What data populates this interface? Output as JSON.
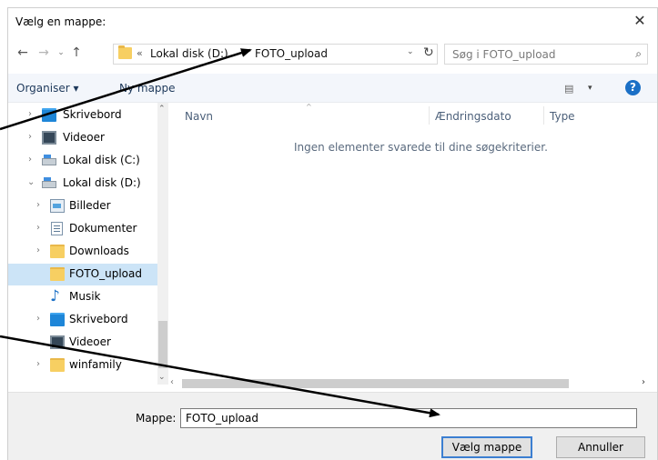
{
  "window": {
    "title": "Vælg en mappe:",
    "close_glyph": "✕"
  },
  "address_bar": {
    "back_glyph": "←",
    "forward_glyph": "→",
    "history_glyph": "⌄",
    "up_glyph": "↑",
    "overflow": "«",
    "crumbs": [
      "Lokal disk (D:)",
      "FOTO_upload"
    ],
    "separator": "›",
    "dropdown_glyph": "⌄",
    "refresh_glyph": "↻"
  },
  "search": {
    "placeholder": "Søg i FOTO_upload",
    "icon_glyph": "⌕"
  },
  "toolbar": {
    "organise_label": "Organiser ▾",
    "new_folder_label": "Ny mappe",
    "view_glyph": "▤",
    "view_dropdown_glyph": "▾",
    "help_glyph": "?"
  },
  "nav_tree": {
    "items": [
      {
        "label": "Skrivebord",
        "icon": "desktop-icon",
        "arrow": "›"
      },
      {
        "label": "Videoer",
        "icon": "video-icon",
        "arrow": "›"
      },
      {
        "label": "Lokal disk (C:)",
        "icon": "drive-icon",
        "arrow": "›"
      },
      {
        "label": "Lokal disk (D:)",
        "icon": "drive-icon",
        "arrow": "⌄"
      },
      {
        "label": "Billeder",
        "icon": "pictures-icon",
        "arrow": "›"
      },
      {
        "label": "Dokumenter",
        "icon": "documents-icon",
        "arrow": "›"
      },
      {
        "label": "Downloads",
        "icon": "folder-icon",
        "arrow": "›"
      },
      {
        "label": "FOTO_upload",
        "icon": "folder-icon",
        "arrow": ""
      },
      {
        "label": "Musik",
        "icon": "music-icon",
        "arrow": ""
      },
      {
        "label": "Skrivebord",
        "icon": "desktop-icon",
        "arrow": "›"
      },
      {
        "label": "Videoer",
        "icon": "video-icon",
        "arrow": ""
      },
      {
        "label": "winfamily",
        "icon": "folder-icon",
        "arrow": "›"
      }
    ],
    "selected_item": "FOTO_upload"
  },
  "scrollbars": {
    "up_glyph": "⌃",
    "down_glyph": "⌄",
    "left_glyph": "‹",
    "right_glyph": "›"
  },
  "file_list": {
    "columns": [
      "Navn",
      "Ændringsdato",
      "Type"
    ],
    "sort_glyph": "^",
    "empty_message": "Ingen elementer svarede til dine søgekriterier."
  },
  "footer": {
    "folder_label": "Mappe:",
    "folder_value": "FOTO_upload",
    "select_button": "Vælg mappe",
    "cancel_button": "Annuller"
  },
  "colors": {
    "selected_row": "#cce4f7",
    "toolbar_bg": "#f3f6fb",
    "default_button_border": "#3c7fd1",
    "annotation_arrow": "#000000"
  }
}
